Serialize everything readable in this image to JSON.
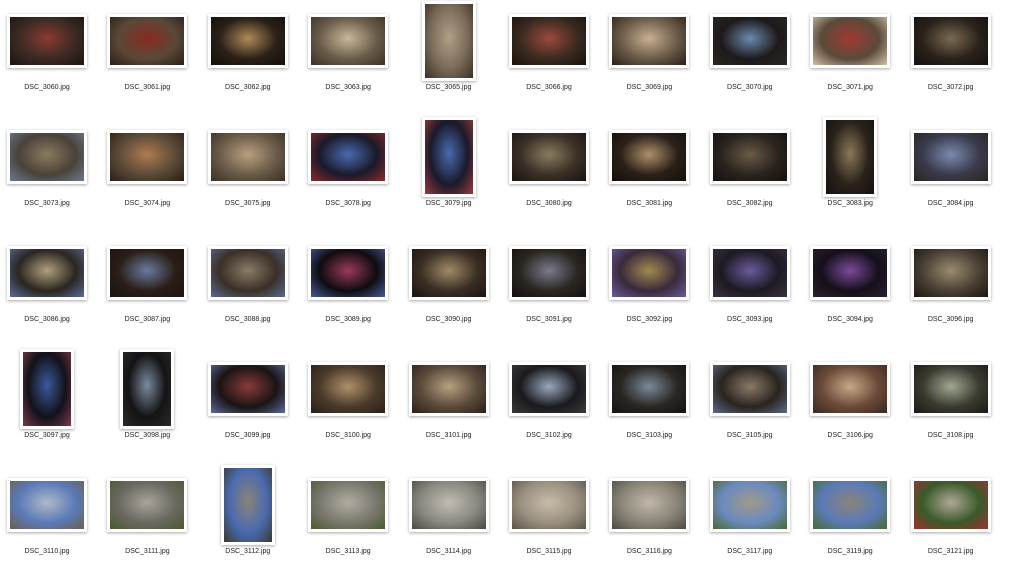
{
  "files": [
    {
      "name": "DSC_3060.jpg",
      "orientation": "landscape",
      "tone": [
        "#3a2a22",
        "#8a3a32",
        "#1c1410"
      ]
    },
    {
      "name": "DSC_3061.jpg",
      "orientation": "landscape",
      "tone": [
        "#5a4838",
        "#8a2a22",
        "#2a1e16"
      ]
    },
    {
      "name": "DSC_3062.jpg",
      "orientation": "landscape",
      "tone": [
        "#2a2018",
        "#b08a58",
        "#141008"
      ]
    },
    {
      "name": "DSC_3063.jpg",
      "orientation": "landscape",
      "tone": [
        "#6a5c4a",
        "#c8b898",
        "#3a3024"
      ]
    },
    {
      "name": "DSC_3065.jpg",
      "orientation": "portrait",
      "tone": [
        "#7a6a58",
        "#b0a088",
        "#3a3024"
      ]
    },
    {
      "name": "DSC_3066.jpg",
      "orientation": "landscape",
      "tone": [
        "#3a2a20",
        "#9a4a3a",
        "#1a120c"
      ]
    },
    {
      "name": "DSC_3069.jpg",
      "orientation": "landscape",
      "tone": [
        "#6a5a48",
        "#c8b090",
        "#2a2018"
      ]
    },
    {
      "name": "DSC_3070.jpg",
      "orientation": "landscape",
      "tone": [
        "#1e1a1a",
        "#6a8ab0",
        "#2a2622"
      ]
    },
    {
      "name": "DSC_3071.jpg",
      "orientation": "landscape",
      "tone": [
        "#5a4a3a",
        "#a03a32",
        "#d0c0a8"
      ]
    },
    {
      "name": "DSC_3072.jpg",
      "orientation": "landscape",
      "tone": [
        "#2a221a",
        "#7a6a50",
        "#141010"
      ]
    },
    {
      "name": "DSC_3073.jpg",
      "orientation": "landscape",
      "tone": [
        "#4a4238",
        "#8a7a60",
        "#6a7a90"
      ]
    },
    {
      "name": "DSC_3074.jpg",
      "orientation": "landscape",
      "tone": [
        "#5a4a38",
        "#b07a50",
        "#2a1e14"
      ]
    },
    {
      "name": "DSC_3075.jpg",
      "orientation": "landscape",
      "tone": [
        "#6a5a48",
        "#b8a080",
        "#3a3024"
      ]
    },
    {
      "name": "DSC_3078.jpg",
      "orientation": "landscape",
      "tone": [
        "#1a1a2a",
        "#4a6ab0",
        "#8a2a2a"
      ]
    },
    {
      "name": "DSC_3079.jpg",
      "orientation": "portrait",
      "tone": [
        "#1a1a2a",
        "#4a6ab0",
        "#9a3a3a"
      ]
    },
    {
      "name": "DSC_3080.jpg",
      "orientation": "landscape",
      "tone": [
        "#3a3026",
        "#8a7a60",
        "#1a1410"
      ]
    },
    {
      "name": "DSC_3081.jpg",
      "orientation": "landscape",
      "tone": [
        "#2a2018",
        "#b09068",
        "#141008"
      ]
    },
    {
      "name": "DSC_3082.jpg",
      "orientation": "landscape",
      "tone": [
        "#2a241e",
        "#6a5a48",
        "#141010"
      ]
    },
    {
      "name": "DSC_3083.jpg",
      "orientation": "portrait",
      "tone": [
        "#2a221a",
        "#8a7858",
        "#141010"
      ]
    },
    {
      "name": "DSC_3084.jpg",
      "orientation": "landscape",
      "tone": [
        "#3a3a4a",
        "#7a8ab0",
        "#2a2420"
      ]
    },
    {
      "name": "DSC_3086.jpg",
      "orientation": "landscape",
      "tone": [
        "#2a2620",
        "#b0a080",
        "#5a6a9a"
      ]
    },
    {
      "name": "DSC_3087.jpg",
      "orientation": "landscape",
      "tone": [
        "#2a1e16",
        "#6a7aa0",
        "#1a1410"
      ]
    },
    {
      "name": "DSC_3088.jpg",
      "orientation": "landscape",
      "tone": [
        "#3a3026",
        "#8a7a68",
        "#5a6a90"
      ]
    },
    {
      "name": "DSC_3089.jpg",
      "orientation": "landscape",
      "tone": [
        "#0e0c10",
        "#9a3a5a",
        "#4a5a9a"
      ]
    },
    {
      "name": "DSC_3090.jpg",
      "orientation": "landscape",
      "tone": [
        "#3a2e24",
        "#a08a68",
        "#1a1410"
      ]
    },
    {
      "name": "DSC_3091.jpg",
      "orientation": "landscape",
      "tone": [
        "#2a2622",
        "#7a7a8a",
        "#141010"
      ]
    },
    {
      "name": "DSC_3092.jpg",
      "orientation": "landscape",
      "tone": [
        "#3a2a3a",
        "#a08a50",
        "#6a5aa0"
      ]
    },
    {
      "name": "DSC_3093.jpg",
      "orientation": "landscape",
      "tone": [
        "#1e1a24",
        "#6a5a9a",
        "#3a3040"
      ]
    },
    {
      "name": "DSC_3094.jpg",
      "orientation": "landscape",
      "tone": [
        "#14101a",
        "#7a4a9a",
        "#2a2030"
      ]
    },
    {
      "name": "DSC_3096.jpg",
      "orientation": "landscape",
      "tone": [
        "#4a4034",
        "#9a8a70",
        "#1a1610"
      ]
    },
    {
      "name": "DSC_3097.jpg",
      "orientation": "portrait",
      "tone": [
        "#12121a",
        "#3a5a9a",
        "#7a3a4a"
      ]
    },
    {
      "name": "DSC_3098.jpg",
      "orientation": "portrait",
      "tone": [
        "#141414",
        "#7a8aa0",
        "#2a2a2a"
      ]
    },
    {
      "name": "DSC_3099.jpg",
      "orientation": "landscape",
      "tone": [
        "#1a1414",
        "#8a3a3a",
        "#5a6a9a"
      ]
    },
    {
      "name": "DSC_3100.jpg",
      "orientation": "landscape",
      "tone": [
        "#4a3a2a",
        "#b0906a",
        "#2a2018"
      ]
    },
    {
      "name": "DSC_3101.jpg",
      "orientation": "landscape",
      "tone": [
        "#5a4a3a",
        "#b8a080",
        "#2a2018"
      ]
    },
    {
      "name": "DSC_3102.jpg",
      "orientation": "landscape",
      "tone": [
        "#1a1a1e",
        "#9aa8c0",
        "#3a3a3a"
      ]
    },
    {
      "name": "DSC_3103.jpg",
      "orientation": "landscape",
      "tone": [
        "#2a2622",
        "#7a8a9a",
        "#141212"
      ]
    },
    {
      "name": "DSC_3105.jpg",
      "orientation": "landscape",
      "tone": [
        "#2a241e",
        "#8a7a68",
        "#5a6a8a"
      ]
    },
    {
      "name": "DSC_3106.jpg",
      "orientation": "landscape",
      "tone": [
        "#6a4a38",
        "#c8a888",
        "#3a2820"
      ]
    },
    {
      "name": "DSC_3108.jpg",
      "orientation": "landscape",
      "tone": [
        "#3a3a30",
        "#a0a890",
        "#1a1a14"
      ]
    },
    {
      "name": "DSC_3110.jpg",
      "orientation": "landscape",
      "tone": [
        "#5a7ab8",
        "#b0b8c8",
        "#6a6050"
      ]
    },
    {
      "name": "DSC_3111.jpg",
      "orientation": "landscape",
      "tone": [
        "#6a6860",
        "#a8a498",
        "#4a5a30"
      ]
    },
    {
      "name": "DSC_3112.jpg",
      "orientation": "portrait",
      "tone": [
        "#4a6ab0",
        "#8a8478",
        "#3a3a30"
      ]
    },
    {
      "name": "DSC_3113.jpg",
      "orientation": "landscape",
      "tone": [
        "#7a786e",
        "#b0aca0",
        "#4a5a30"
      ]
    },
    {
      "name": "DSC_3114.jpg",
      "orientation": "landscape",
      "tone": [
        "#8a8880",
        "#c0bcb0",
        "#4a4a40"
      ]
    },
    {
      "name": "DSC_3115.jpg",
      "orientation": "landscape",
      "tone": [
        "#9a9080",
        "#c8bca8",
        "#5a5448"
      ]
    },
    {
      "name": "DSC_3116.jpg",
      "orientation": "landscape",
      "tone": [
        "#8a8478",
        "#c0b8a8",
        "#4a4a40"
      ]
    },
    {
      "name": "DSC_3117.jpg",
      "orientation": "landscape",
      "tone": [
        "#6a8ac0",
        "#a09a88",
        "#4a6a30"
      ]
    },
    {
      "name": "DSC_3119.jpg",
      "orientation": "landscape",
      "tone": [
        "#5a7ab8",
        "#8a8478",
        "#4a6a30"
      ]
    },
    {
      "name": "DSC_3121.jpg",
      "orientation": "landscape",
      "tone": [
        "#3a5a2a",
        "#b0a898",
        "#a03030"
      ]
    }
  ]
}
